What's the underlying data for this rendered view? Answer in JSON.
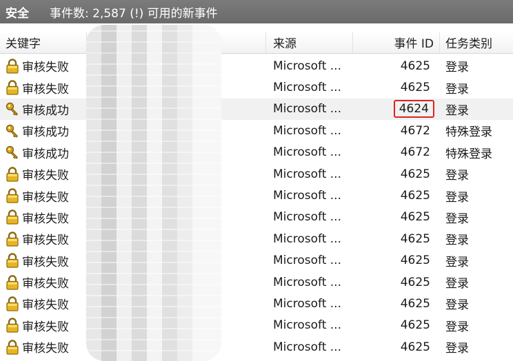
{
  "titlebar": {
    "log_name": "安全",
    "event_count": "事件数: 2,587 (!) 可用的新事件"
  },
  "columns": {
    "keyword": "关键字",
    "source": "来源",
    "event_id": "事件 ID",
    "category": "任务类别"
  },
  "rows": [
    {
      "keyword": "审核失败",
      "icon": "lock-icon",
      "source": "Microsoft ...",
      "event_id": "4625",
      "category": "登录"
    },
    {
      "keyword": "审核失败",
      "icon": "lock-icon",
      "source": "Microsoft ...",
      "event_id": "4625",
      "category": "登录"
    },
    {
      "keyword": "审核成功",
      "icon": "key-icon",
      "source": "Microsoft ...",
      "event_id": "4624",
      "category": "登录"
    },
    {
      "keyword": "审核成功",
      "icon": "key-icon",
      "source": "Microsoft ...",
      "event_id": "4672",
      "category": "特殊登录"
    },
    {
      "keyword": "审核成功",
      "icon": "key-icon",
      "source": "Microsoft ...",
      "event_id": "4672",
      "category": "特殊登录"
    },
    {
      "keyword": "审核失败",
      "icon": "lock-icon",
      "source": "Microsoft ...",
      "event_id": "4625",
      "category": "登录"
    },
    {
      "keyword": "审核失败",
      "icon": "lock-icon",
      "source": "Microsoft ...",
      "event_id": "4625",
      "category": "登录"
    },
    {
      "keyword": "审核失败",
      "icon": "lock-icon",
      "source": "Microsoft ...",
      "event_id": "4625",
      "category": "登录"
    },
    {
      "keyword": "审核失败",
      "icon": "lock-icon",
      "source": "Microsoft ...",
      "event_id": "4625",
      "category": "登录"
    },
    {
      "keyword": "审核失败",
      "icon": "lock-icon",
      "source": "Microsoft ...",
      "event_id": "4625",
      "category": "登录"
    },
    {
      "keyword": "审核失败",
      "icon": "lock-icon",
      "source": "Microsoft ...",
      "event_id": "4625",
      "category": "登录"
    },
    {
      "keyword": "审核失败",
      "icon": "lock-icon",
      "source": "Microsoft ...",
      "event_id": "4625",
      "category": "登录"
    },
    {
      "keyword": "审核失败",
      "icon": "lock-icon",
      "source": "Microsoft ...",
      "event_id": "4625",
      "category": "登录"
    },
    {
      "keyword": "审核失败",
      "icon": "lock-icon",
      "source": "Microsoft ...",
      "event_id": "4625",
      "category": "登录"
    }
  ],
  "highlight": {
    "row_index": 2,
    "color": "#e0201e"
  },
  "selected_row_index": 2
}
